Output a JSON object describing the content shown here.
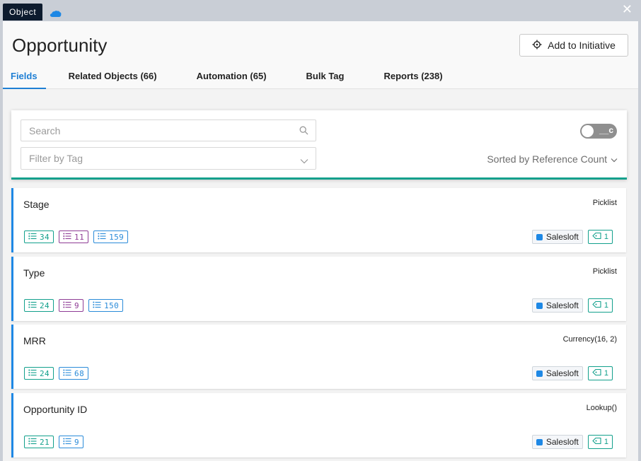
{
  "window": {
    "object_tag": "Object",
    "close_symbol": "✕",
    "cloud_icon": "salesforce-cloud-icon",
    "cloud_color": "#1e88e5"
  },
  "header": {
    "title": "Opportunity",
    "add_button_label": "Add to Initiative",
    "add_button_icon": "target-icon"
  },
  "tabs": [
    {
      "label": "Fields",
      "active": true
    },
    {
      "label": "Related Objects (66)",
      "active": false
    },
    {
      "label": "Automation (65)",
      "active": false
    },
    {
      "label": "Bulk Tag",
      "active": false
    },
    {
      "label": "Reports (238)",
      "active": false
    }
  ],
  "controls": {
    "search_placeholder": "Search",
    "filter_placeholder": "Filter by Tag",
    "toggle_label": "__c",
    "toggle_on": false,
    "sort_label": "Sorted by Reference Count"
  },
  "colors": {
    "accent_blue": "#1e7fd4",
    "teal": "#12a08c",
    "purple": "#8e3c95",
    "badge_blue": "#2a8bd9"
  },
  "fields": [
    {
      "name": "Stage",
      "type": "Picklist",
      "badges": [
        {
          "value": "34",
          "style": "teal"
        },
        {
          "value": "11",
          "style": "purple"
        },
        {
          "value": "159",
          "style": "blue"
        }
      ],
      "system": "Salesloft",
      "tag_count": "1"
    },
    {
      "name": "Type",
      "type": "Picklist",
      "badges": [
        {
          "value": "24",
          "style": "teal"
        },
        {
          "value": "9",
          "style": "purple"
        },
        {
          "value": "150",
          "style": "blue"
        }
      ],
      "system": "Salesloft",
      "tag_count": "1"
    },
    {
      "name": "MRR",
      "type": "Currency(16, 2)",
      "badges": [
        {
          "value": "24",
          "style": "teal"
        },
        {
          "value": "68",
          "style": "blue"
        }
      ],
      "system": "Salesloft",
      "tag_count": "1"
    },
    {
      "name": "Opportunity ID",
      "type": "Lookup()",
      "badges": [
        {
          "value": "21",
          "style": "teal"
        },
        {
          "value": "9",
          "style": "blue"
        }
      ],
      "system": "Salesloft",
      "tag_count": "1"
    }
  ]
}
